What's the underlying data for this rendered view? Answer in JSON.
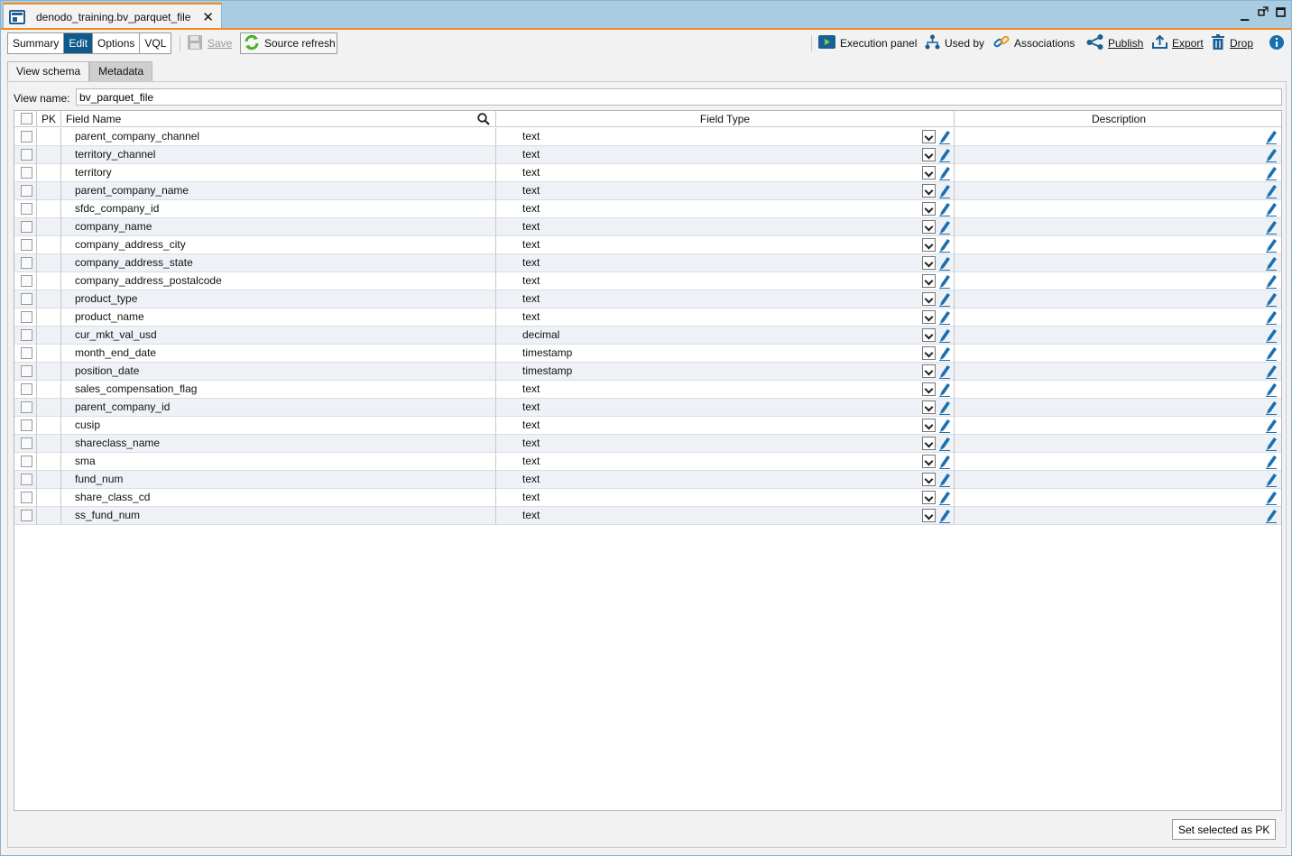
{
  "window": {
    "tab_title": "denodo_training.bv_parquet_file"
  },
  "toolbar": {
    "modes": [
      "Summary",
      "Edit",
      "Options",
      "VQL"
    ],
    "active_mode": "Edit",
    "save_label": "Save",
    "refresh_label": "Source refresh",
    "right_actions": [
      "Execution panel",
      "Used by",
      "Associations",
      "Publish",
      "Export",
      "Drop"
    ]
  },
  "subtabs": [
    "View schema",
    "Metadata"
  ],
  "view_name": {
    "label": "View name:",
    "value": "bv_parquet_file"
  },
  "table": {
    "headers": {
      "pk": "PK",
      "field_name": "Field Name",
      "field_type": "Field Type",
      "description": "Description"
    },
    "rows": [
      {
        "name": "parent_company_channel",
        "type": "text"
      },
      {
        "name": "territory_channel",
        "type": "text"
      },
      {
        "name": "territory",
        "type": "text"
      },
      {
        "name": "parent_company_name",
        "type": "text"
      },
      {
        "name": "sfdc_company_id",
        "type": "text"
      },
      {
        "name": "company_name",
        "type": "text"
      },
      {
        "name": "company_address_city",
        "type": "text"
      },
      {
        "name": "company_address_state",
        "type": "text"
      },
      {
        "name": "company_address_postalcode",
        "type": "text"
      },
      {
        "name": "product_type",
        "type": "text"
      },
      {
        "name": "product_name",
        "type": "text"
      },
      {
        "name": "cur_mkt_val_usd",
        "type": "decimal"
      },
      {
        "name": "month_end_date",
        "type": "timestamp"
      },
      {
        "name": "position_date",
        "type": "timestamp"
      },
      {
        "name": "sales_compensation_flag",
        "type": "text"
      },
      {
        "name": "parent_company_id",
        "type": "text"
      },
      {
        "name": "cusip",
        "type": "text"
      },
      {
        "name": "shareclass_name",
        "type": "text"
      },
      {
        "name": "sma",
        "type": "text"
      },
      {
        "name": "fund_num",
        "type": "text"
      },
      {
        "name": "share_class_cd",
        "type": "text"
      },
      {
        "name": "ss_fund_num",
        "type": "text"
      }
    ]
  },
  "footer": {
    "set_pk_label": "Set selected as PK"
  },
  "colors": {
    "accent": "#0e5a8a",
    "tab_border": "#f08a1c",
    "icon_blue": "#1a6fb0",
    "refresh_green": "#4caf2a"
  }
}
